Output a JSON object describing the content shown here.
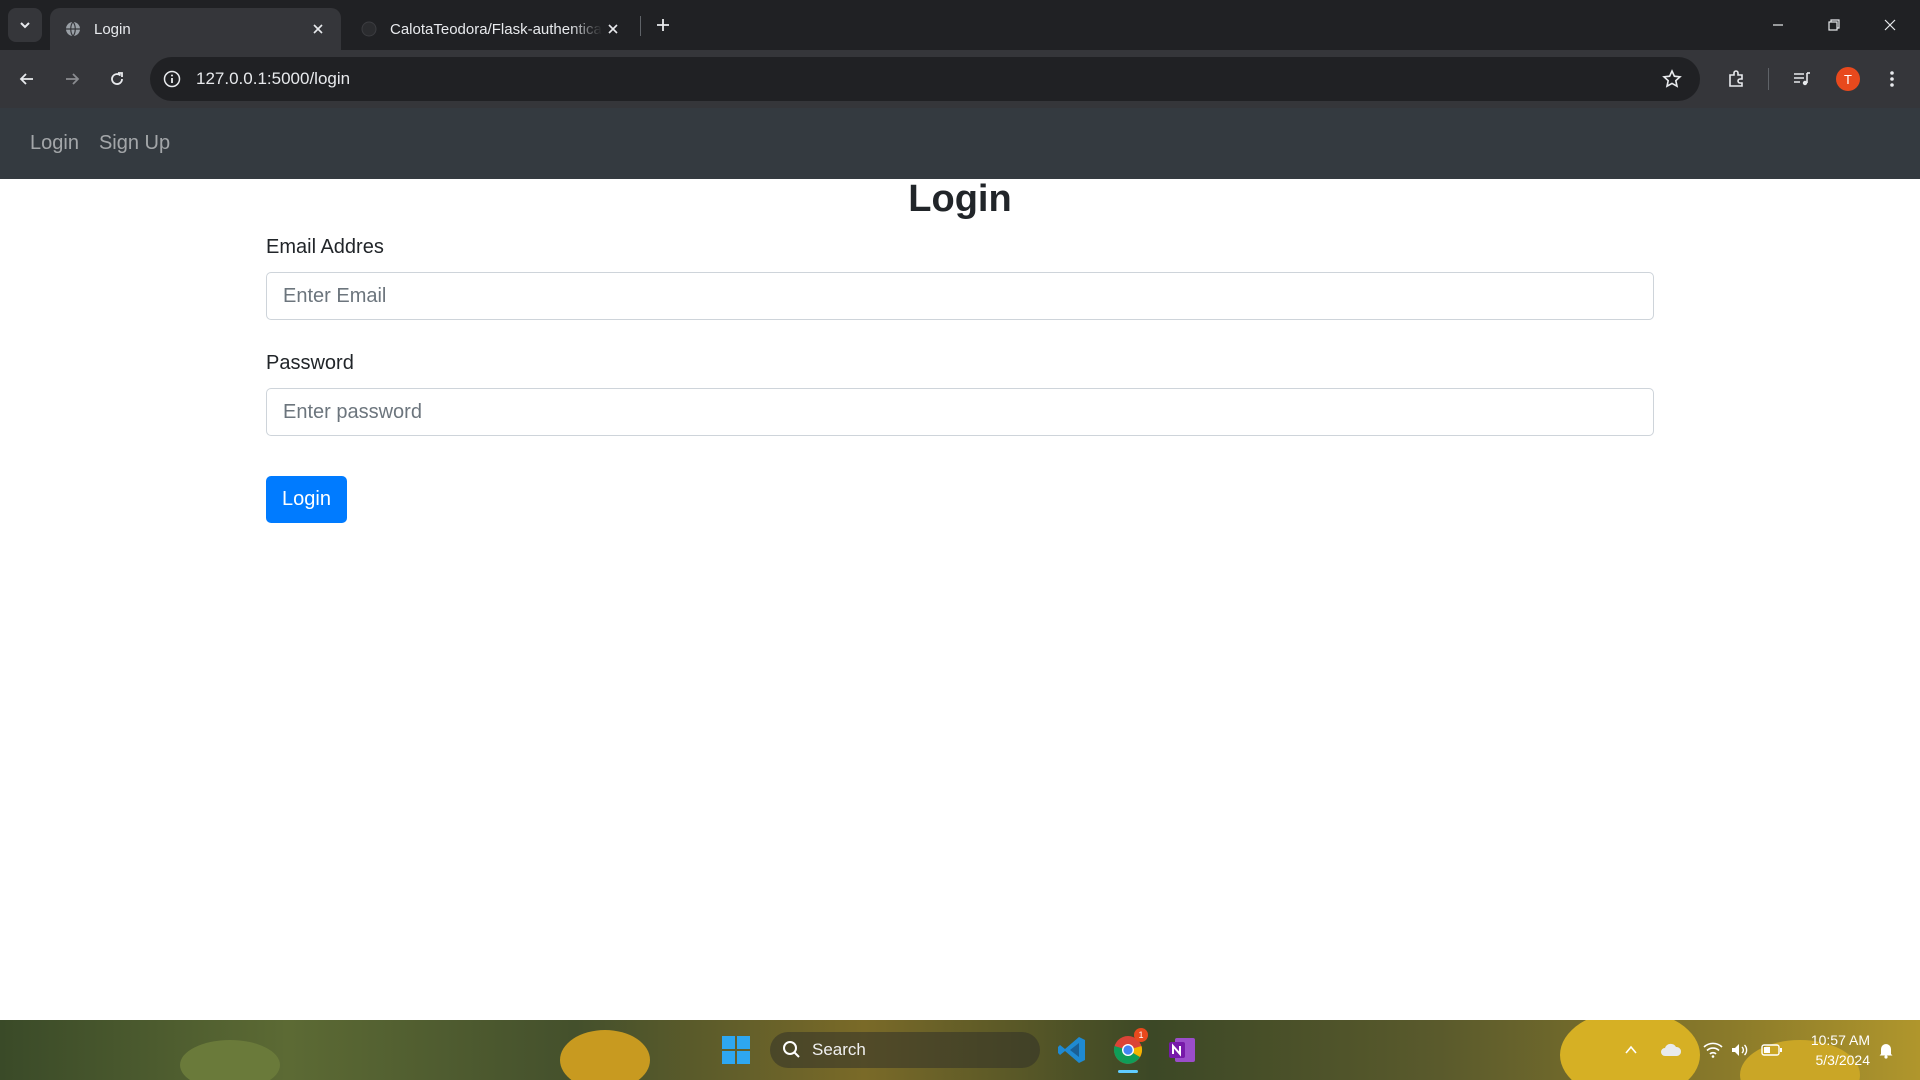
{
  "browser": {
    "tabs": [
      {
        "title": "Login",
        "active": true
      },
      {
        "title": "CalotaTeodora/Flask-authentication",
        "active": false
      }
    ],
    "url": "127.0.0.1:5000/login",
    "profile_initial": "T"
  },
  "site_nav": {
    "links": [
      "Login",
      "Sign Up"
    ]
  },
  "page": {
    "heading": "Login",
    "email_label": "Email Addres",
    "email_placeholder": "Enter Email",
    "password_label": "Password",
    "password_placeholder": "Enter password",
    "submit_label": "Login"
  },
  "taskbar": {
    "search_placeholder": "Search",
    "time": "10:57 AM",
    "date": "5/3/2024",
    "chrome_badge": "1",
    "accent_color": "#007bff",
    "navbar_color": "#343a40"
  }
}
